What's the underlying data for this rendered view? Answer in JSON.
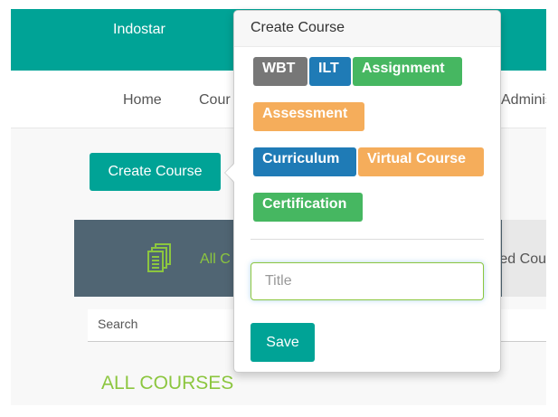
{
  "header": {
    "brand": "Indostar"
  },
  "nav": {
    "items": [
      "Home",
      "Cour",
      "Adminis"
    ]
  },
  "main": {
    "create_course_label": "Create Course",
    "tabs": {
      "all": "All C",
      "completed": "ed Cou"
    },
    "search_label": "Search",
    "section_title": "ALL COURSES"
  },
  "popover": {
    "title": "Create Course",
    "types": [
      {
        "label": "WBT",
        "color": "#777777"
      },
      {
        "label": "ILT",
        "color": "#1f7bb6"
      },
      {
        "label": "Assignment",
        "color": "#46b761"
      },
      {
        "label": "Assessment",
        "color": "#f5ad5b"
      },
      {
        "label": "Curriculum",
        "color": "#1f7bb6"
      },
      {
        "label": "Virtual Course",
        "color": "#f5ad5b"
      },
      {
        "label": "Certification",
        "color": "#46b761"
      }
    ],
    "title_placeholder": "Title",
    "save_label": "Save"
  }
}
